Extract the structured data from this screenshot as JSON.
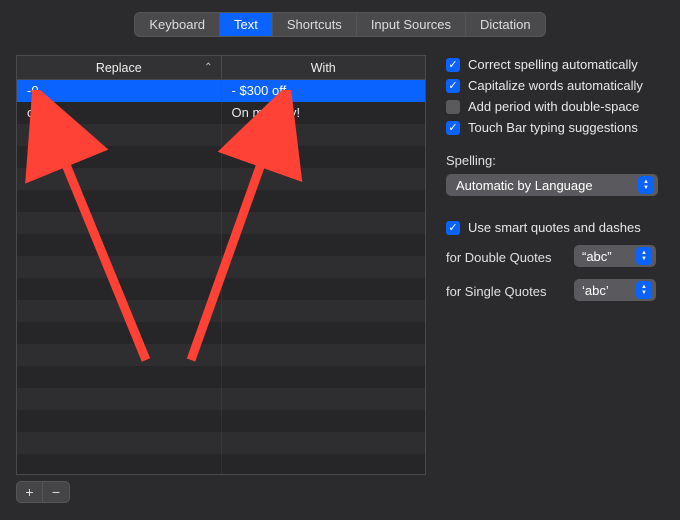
{
  "tabs": {
    "items": [
      "Keyboard",
      "Text",
      "Shortcuts",
      "Input Sources",
      "Dictation"
    ],
    "active_index": 1
  },
  "table": {
    "col_replace": "Replace",
    "col_with": "With",
    "rows": [
      {
        "replace": "-0",
        "with": "- $300 off",
        "selected": true
      },
      {
        "replace": "omw",
        "with": "On my way!",
        "selected": false
      }
    ]
  },
  "buttons": {
    "add": "+",
    "remove": "−"
  },
  "options": {
    "correct_spelling": {
      "label": "Correct spelling automatically",
      "checked": true
    },
    "capitalize": {
      "label": "Capitalize words automatically",
      "checked": true
    },
    "add_period": {
      "label": "Add period with double-space",
      "checked": false
    },
    "touchbar": {
      "label": "Touch Bar typing suggestions",
      "checked": true
    },
    "spelling_label": "Spelling:",
    "spelling_value": "Automatic by Language",
    "smart_quotes": {
      "label": "Use smart quotes and dashes",
      "checked": true
    },
    "double_quotes_label": "for Double Quotes",
    "double_quotes_value": "“abc”",
    "single_quotes_label": "for Single Quotes",
    "single_quotes_value": "‘abc’"
  },
  "annotation": {
    "arrow_color": "#ff4136"
  }
}
